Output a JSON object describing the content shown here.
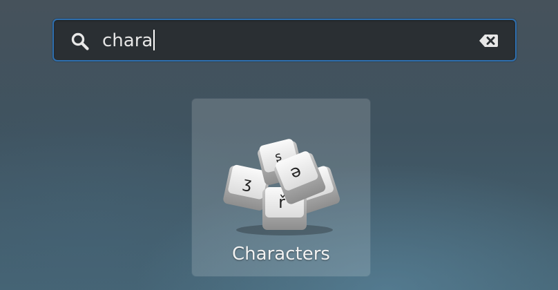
{
  "search": {
    "value": "chara",
    "search_icon": "search-icon",
    "clear_icon": "clear-text-icon",
    "accent_color": "#2f6fae"
  },
  "results": [
    {
      "label": "Characters",
      "icon": "characters-app-icon",
      "key_glyphs": [
        "ʂ",
        "ə",
        "ʒ",
        "ř"
      ]
    }
  ]
}
